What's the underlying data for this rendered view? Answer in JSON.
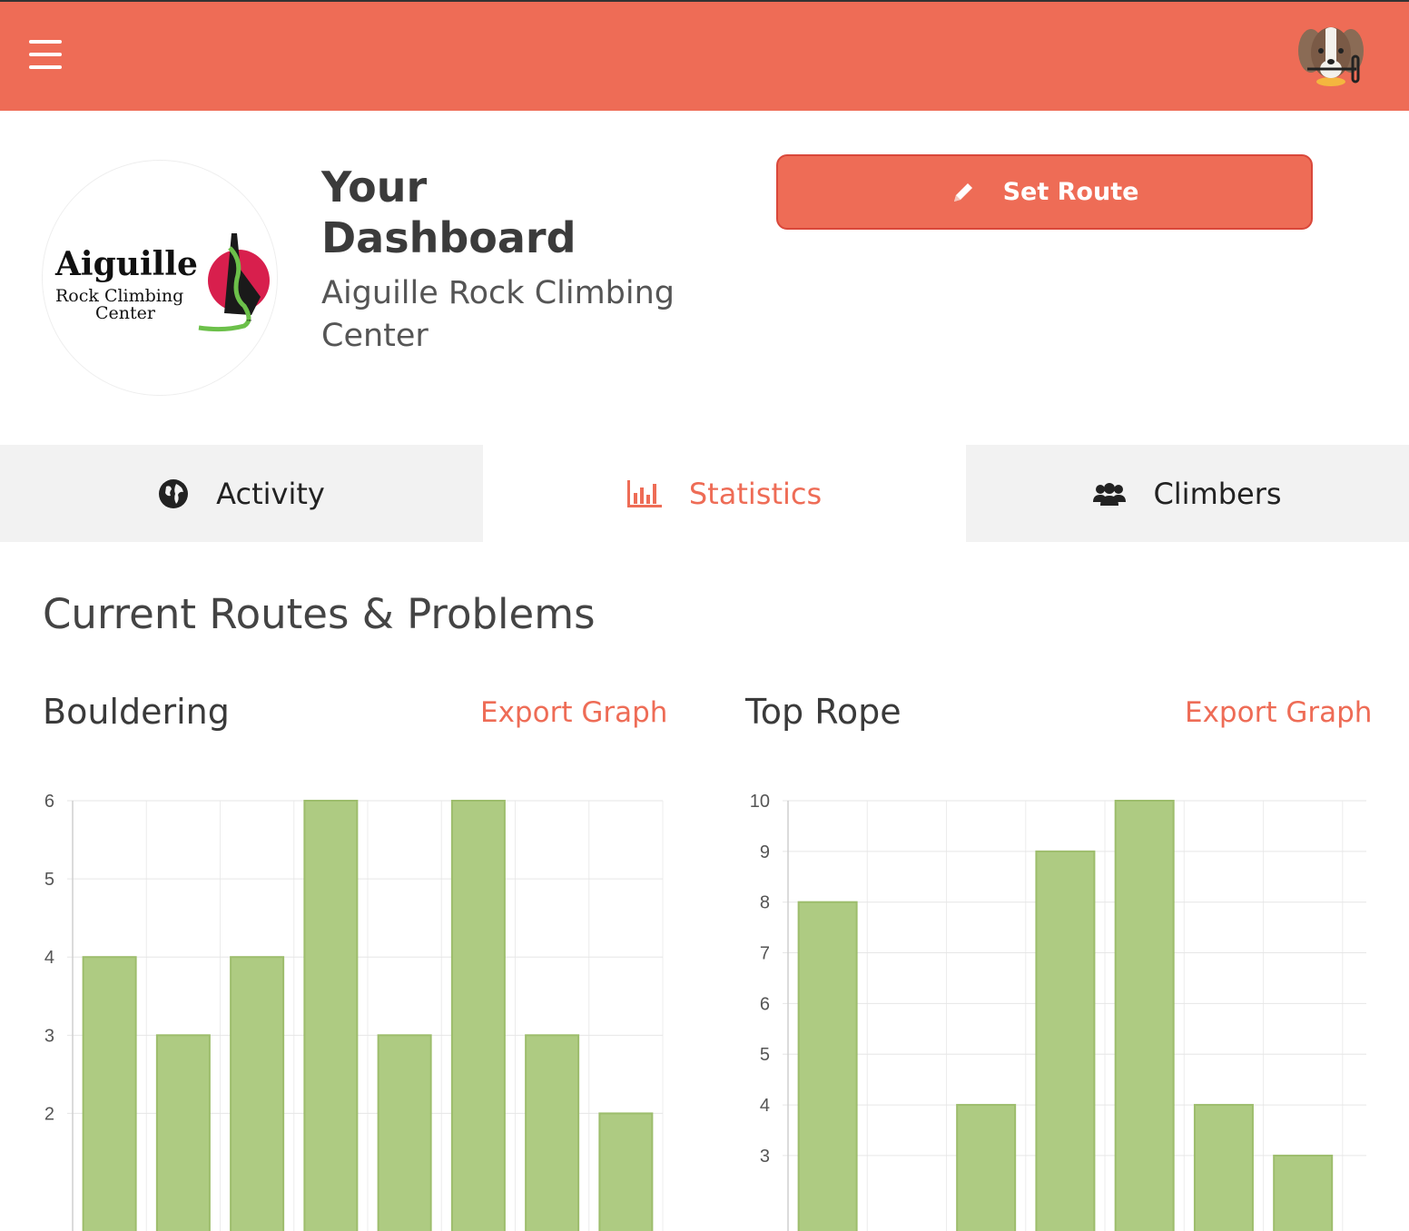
{
  "header": {
    "menu_icon": "hamburger-menu-icon",
    "avatar_icon": "dog-avatar-icon",
    "colors": {
      "brand": "#ee6c56"
    }
  },
  "profile": {
    "title": "Your Dashboard",
    "gym_name": "Aiguille Rock Climbing Center",
    "logo": {
      "wordmark": "Aiguille",
      "line1": "Rock Climbing",
      "line2": "Center",
      "tm": "™"
    }
  },
  "actions": {
    "set_route_label": "Set Route",
    "set_route_icon": "pencil-icon"
  },
  "tabs": [
    {
      "label": "Activity",
      "icon": "globe-icon",
      "active": false
    },
    {
      "label": "Statistics",
      "icon": "bar-chart-icon",
      "active": true
    },
    {
      "label": "Climbers",
      "icon": "users-icon",
      "active": false
    }
  ],
  "main": {
    "section_title": "Current Routes & Problems",
    "export_label": "Export Graph"
  },
  "chart_data": [
    {
      "type": "bar",
      "title": "Bouldering",
      "values": [
        4,
        3,
        4,
        6,
        3,
        6,
        3,
        2
      ],
      "yticks": [
        2,
        3,
        4,
        5,
        6
      ],
      "ylim_visible": [
        1.25,
        6
      ],
      "bar_color": "#aecb82",
      "grid": true
    },
    {
      "type": "bar",
      "title": "Top Rope",
      "values": [
        8,
        0,
        4,
        9,
        10,
        4,
        3
      ],
      "yticks": [
        3,
        4,
        5,
        6,
        7,
        8,
        9,
        10
      ],
      "ylim_visible": [
        2.3,
        10
      ],
      "bar_color": "#aecb82",
      "grid": true
    }
  ]
}
